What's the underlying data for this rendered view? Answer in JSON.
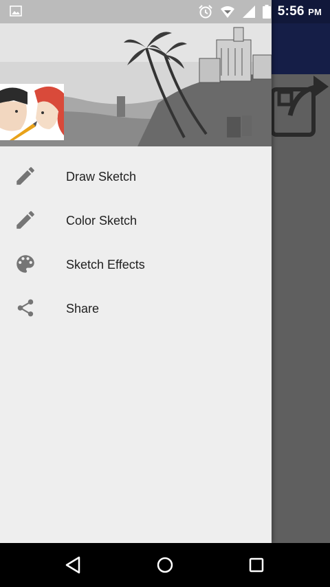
{
  "status_bar": {
    "time": "5:56",
    "ampm": "PM",
    "icons": [
      "image-notification-icon",
      "alarm-icon",
      "wifi-icon",
      "signal-icon",
      "battery-icon"
    ]
  },
  "drawer": {
    "menu_items": [
      {
        "label": "Draw Sketch",
        "icon": "pencil-icon"
      },
      {
        "label": "Color Sketch",
        "icon": "pencil-icon"
      },
      {
        "label": "Sketch Effects",
        "icon": "palette-icon"
      },
      {
        "label": "Share",
        "icon": "share-icon"
      }
    ]
  },
  "background_app": {
    "toolbar_color": "#151e47",
    "save_icon": "save-share-icon"
  },
  "nav_bar": {
    "buttons": [
      "back-icon",
      "home-icon",
      "recents-icon"
    ]
  },
  "colors": {
    "drawer_bg": "#eeeeee",
    "icon_gray": "#757575",
    "text": "#212121",
    "scrim": "#5f5f5f"
  }
}
